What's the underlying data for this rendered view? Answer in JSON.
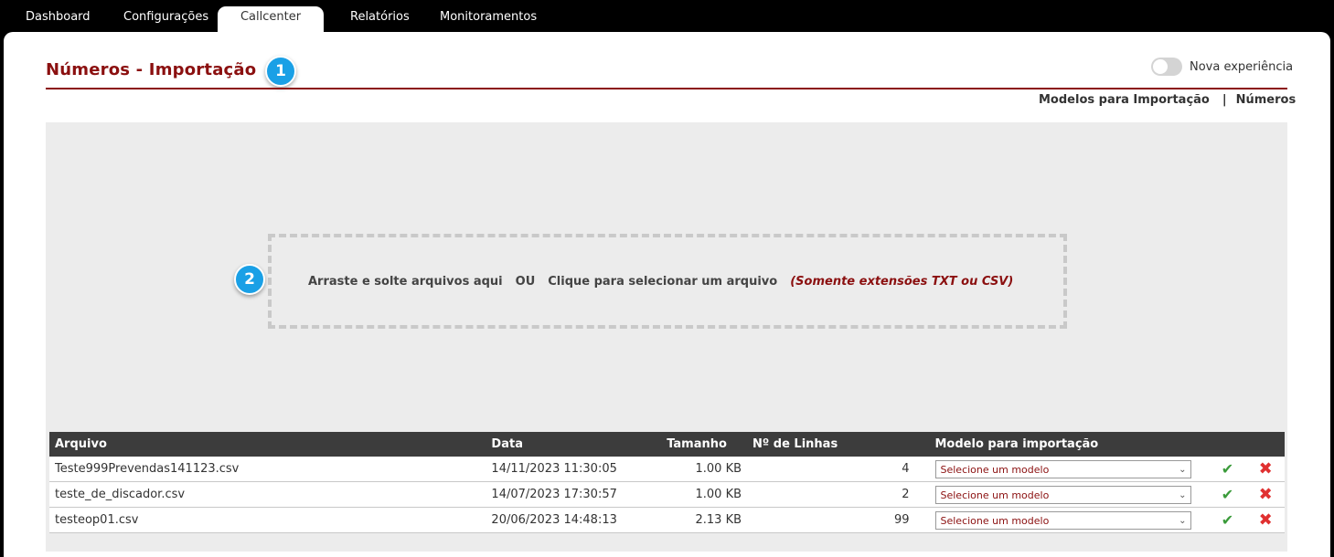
{
  "nav": {
    "tabs": [
      {
        "label": "Dashboard"
      },
      {
        "label": "Configurações"
      },
      {
        "label": "Callcenter"
      },
      {
        "label": "Relatórios"
      },
      {
        "label": "Monitoramentos"
      }
    ]
  },
  "page": {
    "title": "Números - Importação",
    "badge1": "1",
    "badge2": "2",
    "toggle_label": "Nova experiência",
    "sublinks": [
      "Modelos para Importação",
      "|",
      "Números"
    ]
  },
  "dropzone": {
    "drag_text": "Arraste e solte arquivos aqui",
    "or_text": "OU",
    "click_text": "Clique para selecionar um arquivo",
    "ext_text": "(Somente extensões TXT ou CSV)"
  },
  "table": {
    "headers": [
      "Arquivo",
      "Data",
      "Tamanho",
      "Nº de Linhas",
      "Modelo para importação"
    ],
    "rows": [
      {
        "arquivo": "Teste999Prevendas141123.csv",
        "data": "14/11/2023 11:30:05",
        "tamanho": "1.00 KB",
        "linhas": "4",
        "modelo": "Selecione um modelo"
      },
      {
        "arquivo": "teste_de_discador.csv",
        "data": "14/07/2023 17:30:57",
        "tamanho": "1.00 KB",
        "linhas": "2",
        "modelo": "Selecione um modelo"
      },
      {
        "arquivo": "testeop01.csv",
        "data": "20/06/2023 14:48:13",
        "tamanho": "2.13 KB",
        "linhas": "99",
        "modelo": "Selecione um modelo"
      }
    ]
  },
  "icons": {
    "confirm": "check-icon",
    "delete": "close-icon",
    "colors": {
      "confirm": "#3a9b3a",
      "delete": "#e03030",
      "accent": "#8b1010",
      "badge": "#1aa0e6"
    }
  }
}
